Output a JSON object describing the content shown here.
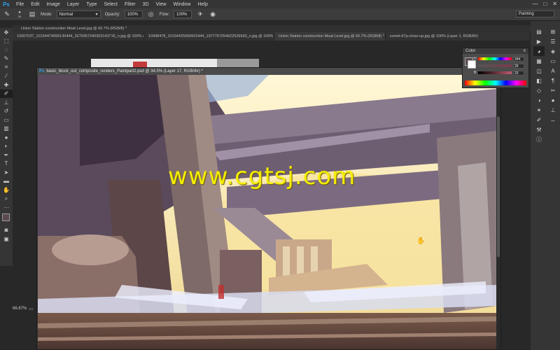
{
  "app": {
    "logo": "Ps"
  },
  "menu": [
    "File",
    "Edit",
    "Image",
    "Layer",
    "Type",
    "Select",
    "Filter",
    "3D",
    "View",
    "Window",
    "Help"
  ],
  "window_controls": [
    "—",
    "□",
    "✕"
  ],
  "options_bar": {
    "mode_label": "Mode:",
    "mode_value": "Normal",
    "opacity_label": "Opacity:",
    "opacity_value": "100%",
    "flow_label": "Flow:",
    "flow_value": "100%",
    "workspace": "Painting",
    "brush_size": "20"
  },
  "tabs": [
    "10007037_10154474099130444_3276957240363143715_n.jpg @ 100% (RGB/...",
    "10498478_10154425069915444_1977767254622526693_o.jpg @ 100% (RGB/...",
    "Union Station construction Moat Level.jpg @ 66.7% (RGB/8) *",
    "comet-67p-close-up.jpg @ 100% (Layer 1, RGB/8#)"
  ],
  "back_doc_title": "Union Station construction Moat Level.jpg @ 66.7% (RGB/8) *",
  "doc_title": "basic_block_out_composite_renders_Paintpart2.psd @ 34.5% (Layer 17, RGB/8#) *",
  "watermark": "www.cgtsj.com",
  "color_panel": {
    "title": "Color",
    "h_label": "H",
    "h_value": "344",
    "s_label": "S",
    "s_value": "26",
    "b_label": "B",
    "b_value": "33",
    "foreground": "#5b4a52",
    "background": "#ffffff"
  },
  "status": {
    "zoom": "66.67%"
  },
  "colors": {
    "accent": "#2fa3e8",
    "watermark": "#f5ee00"
  },
  "tools": [
    "move-icon",
    "marquee-icon",
    "lasso-icon",
    "quick-select-icon",
    "crop-icon",
    "eyedropper-icon",
    "healing-icon",
    "brush-icon",
    "stamp-icon",
    "history-brush-icon",
    "eraser-icon",
    "gradient-icon",
    "blur-icon",
    "dodge-icon",
    "pen-icon",
    "type-icon",
    "path-select-icon",
    "shape-icon",
    "hand-icon",
    "zoom-icon"
  ]
}
